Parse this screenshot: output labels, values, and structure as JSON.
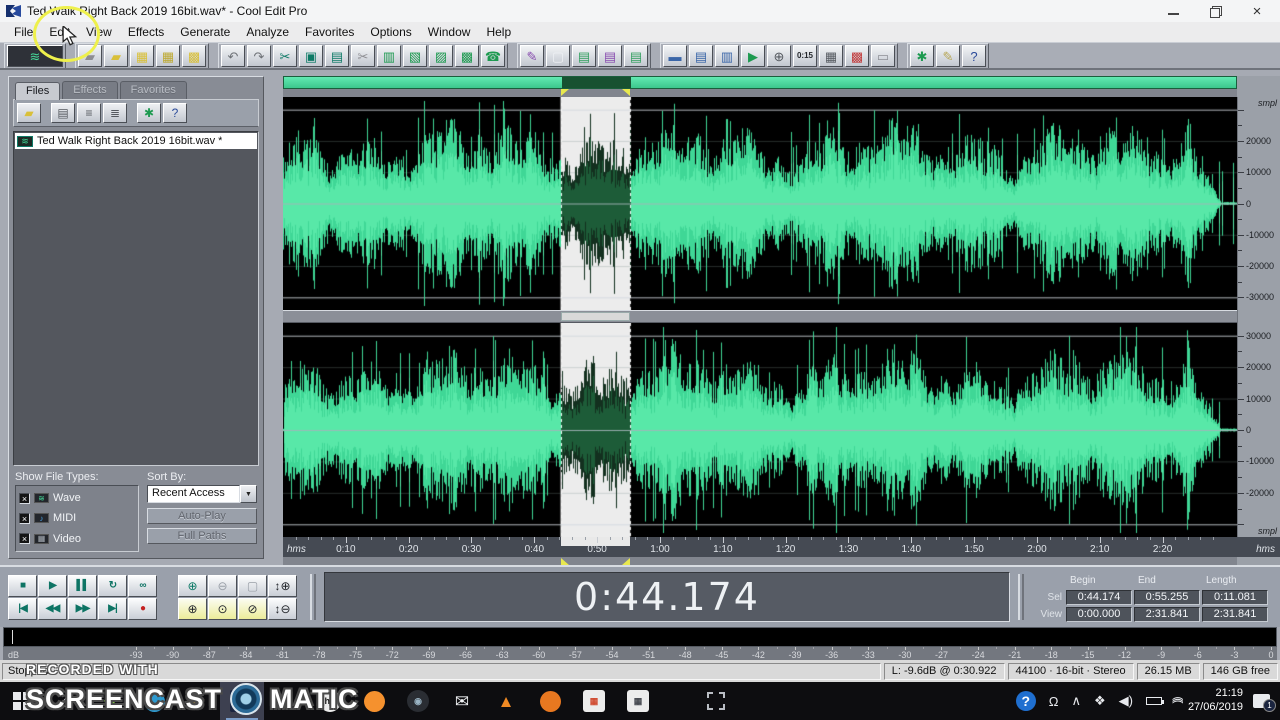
{
  "window": {
    "title": "Ted Walk Right Back 2019 16bit.wav* - Cool Edit Pro",
    "close_glyph": "×"
  },
  "menu": {
    "items": [
      "File",
      "Edit",
      "View",
      "Effects",
      "Generate",
      "Analyze",
      "Favorites",
      "Options",
      "Window",
      "Help"
    ]
  },
  "toolbar": {
    "groups": [
      {
        "name": "view",
        "buttons": [
          {
            "name": "waveform-view-toggle",
            "glyph": "≋",
            "color": "#45d898",
            "wide": true
          }
        ]
      },
      {
        "name": "file",
        "buttons": [
          {
            "name": "new-file-button",
            "glyph": "▰",
            "color": "#8d8d92"
          },
          {
            "name": "open-file-button",
            "glyph": "▰",
            "color": "#d9c03a"
          },
          {
            "name": "save-file-button",
            "glyph": "▦",
            "color": "#d9c03a"
          },
          {
            "name": "save-as-button",
            "glyph": "▦",
            "color": "#bda931"
          },
          {
            "name": "save-all-button",
            "glyph": "▩",
            "color": "#d9c03a"
          }
        ]
      },
      {
        "name": "edit",
        "buttons": [
          {
            "name": "undo-button",
            "glyph": "↶",
            "color": "#6e7277"
          },
          {
            "name": "redo-button",
            "glyph": "↷",
            "color": "#6e7277"
          },
          {
            "name": "cut-button",
            "glyph": "✂",
            "color": "#0d7a66"
          },
          {
            "name": "trim-button",
            "glyph": "▣",
            "color": "#0d7a66"
          },
          {
            "name": "copy-button",
            "glyph": "▤",
            "color": "#0d7a66"
          },
          {
            "name": "delete-button",
            "glyph": "✂",
            "color": "#8d8d92"
          },
          {
            "name": "paste-button",
            "glyph": "▥",
            "color": "#1d9a50"
          },
          {
            "name": "mix-paste-button",
            "glyph": "▧",
            "color": "#1d9a50"
          },
          {
            "name": "paste-to-new-button",
            "glyph": "▨",
            "color": "#1d9a50"
          },
          {
            "name": "convert-sample-type-button",
            "glyph": "▩",
            "color": "#1d9a50"
          },
          {
            "name": "cue-list-button",
            "glyph": "☎",
            "color": "#1d9a50"
          }
        ]
      },
      {
        "name": "mode",
        "buttons": [
          {
            "name": "spectral-view-button",
            "glyph": "✎",
            "color": "#8a4fb0"
          },
          {
            "name": "pan-view-button",
            "glyph": "▢",
            "color": "#eef0f4"
          },
          {
            "name": "multitrack-view-button",
            "glyph": "▤",
            "color": "#34a060"
          },
          {
            "name": "track-mixer-button",
            "glyph": "▤",
            "color": "#8a4fb0"
          },
          {
            "name": "session-view-button",
            "glyph": "▤",
            "color": "#34a060"
          }
        ]
      },
      {
        "name": "window",
        "buttons": [
          {
            "name": "wave-window-button",
            "glyph": "▬",
            "color": "#3a66a8"
          },
          {
            "name": "organizer-window-button",
            "glyph": "▤",
            "color": "#3a66a8"
          },
          {
            "name": "properties-window-button",
            "glyph": "▥",
            "color": "#3a66a8"
          },
          {
            "name": "play-window-button",
            "glyph": "▶",
            "color": "#1d9a50"
          },
          {
            "name": "zoom-window-button",
            "glyph": "⊕",
            "color": "#555a60"
          },
          {
            "name": "time-window-button",
            "glyph": "0:15",
            "color": "#23262b",
            "text": true
          },
          {
            "name": "keyboard-window-button",
            "glyph": "▦",
            "color": "#555a60"
          },
          {
            "name": "mixer-window-button",
            "glyph": "▩",
            "color": "#c23a3a"
          },
          {
            "name": "blank-window-button",
            "glyph": "▭",
            "color": "#8d9096"
          }
        ]
      },
      {
        "name": "misc",
        "buttons": [
          {
            "name": "scripts-button",
            "glyph": "✱",
            "color": "#1d9a50"
          },
          {
            "name": "pencil-tool-button",
            "glyph": "✎",
            "color": "#b8a858"
          },
          {
            "name": "help-button",
            "glyph": "?",
            "color": "#2a4a9a"
          }
        ]
      }
    ]
  },
  "left_panel": {
    "tabs": [
      {
        "label": "Files",
        "active": true
      },
      {
        "label": "Effects",
        "active": false
      },
      {
        "label": "Favorites",
        "active": false
      }
    ],
    "toolbar": [
      {
        "name": "panel-open-file-button",
        "glyph": "▰",
        "color": "#d9c03a"
      },
      {
        "name": "panel-sort-name-button",
        "glyph": "▤",
        "color": "#55595f"
      },
      {
        "name": "panel-sort-type-button",
        "glyph": "≡",
        "color": "#55595f"
      },
      {
        "name": "panel-sort-date-button",
        "glyph": "≣",
        "color": "#55595f"
      },
      {
        "name": "panel-options-button",
        "glyph": "✱",
        "color": "#1d9a50"
      },
      {
        "name": "panel-help-button",
        "glyph": "?",
        "color": "#2a4a9a"
      }
    ],
    "file_icon": {
      "glyph": "≋",
      "color": "#3fd796"
    },
    "files": [
      "Ted Walk Right Back 2019 16bit.wav *"
    ],
    "show_file_types_label": "Show File Types:",
    "check_glyph": "×",
    "file_types": [
      {
        "label": "Wave",
        "icon_glyph": "≋",
        "icon_color": "#45d898"
      },
      {
        "label": "MIDI",
        "icon_glyph": "♪",
        "icon_color": "#4aa3e8"
      },
      {
        "label": "Video",
        "icon_glyph": "▦",
        "icon_color": "#aab0b8"
      }
    ],
    "sort_by_label": "Sort By:",
    "sort_by_value": "Recent Access",
    "dropdown_arrow": "▼",
    "auto_play_label": "Auto-Play",
    "full_paths_label": "Full Paths"
  },
  "waveform": {
    "duration_sec": 151.841,
    "selection_begin_sec": 44.174,
    "selection_end_sec": 55.255,
    "ruler_unit": "smpl",
    "timeline_unit": "hms",
    "ruler_labels_top": [
      20000,
      10000,
      0,
      -10000,
      -20000,
      -30000
    ],
    "ruler_labels_bottom": [
      30000,
      20000,
      10000,
      0,
      -10000,
      -20000
    ],
    "time_ticks": [
      {
        "t": 10,
        "label": "0:10"
      },
      {
        "t": 20,
        "label": "0:20"
      },
      {
        "t": 30,
        "label": "0:30"
      },
      {
        "t": 40,
        "label": "0:40"
      },
      {
        "t": 50,
        "label": "0:50"
      },
      {
        "t": 60,
        "label": "1:00"
      },
      {
        "t": 70,
        "label": "1:10"
      },
      {
        "t": 80,
        "label": "1:20"
      },
      {
        "t": 90,
        "label": "1:30"
      },
      {
        "t": 100,
        "label": "1:40"
      },
      {
        "t": 110,
        "label": "1:50"
      },
      {
        "t": 120,
        "label": "2:00"
      },
      {
        "t": 130,
        "label": "2:10"
      },
      {
        "t": 140,
        "label": "2:20"
      }
    ],
    "colors": {
      "wave": "#3fd796",
      "wave_bright": "#58e8a8",
      "wave_selected": "#1d5c38",
      "wave_selected_dark": "#13301f",
      "selection_bg": "#ececec",
      "background": "#000000",
      "overview_selection": "#175130",
      "marker": "#e8e84e"
    }
  },
  "transport": {
    "rows": [
      [
        {
          "name": "stop-button",
          "glyph": "■",
          "color": "#0e7464"
        },
        {
          "name": "play-button",
          "glyph": "▶",
          "color": "#0e7464"
        },
        {
          "name": "pause-button",
          "glyph": "▌▌",
          "color": "#0e7464"
        },
        {
          "name": "play-looped-button",
          "glyph": "↻",
          "color": "#0e7464"
        },
        {
          "name": "loop-button",
          "glyph": "∞",
          "color": "#0e7464"
        }
      ],
      [
        {
          "name": "go-to-beginning-button",
          "glyph": "|◀",
          "color": "#0e7464"
        },
        {
          "name": "rewind-button",
          "glyph": "◀◀",
          "color": "#0e7464"
        },
        {
          "name": "fast-forward-button",
          "glyph": "▶▶",
          "color": "#0e7464"
        },
        {
          "name": "go-to-end-button",
          "glyph": "▶|",
          "color": "#0e7464"
        },
        {
          "name": "record-button",
          "glyph": "●",
          "color": "#c42222"
        }
      ]
    ]
  },
  "zoom_controls": {
    "rows": [
      [
        {
          "name": "zoom-in-button",
          "glyph": "⊕",
          "color": "#0d7a66"
        },
        {
          "name": "zoom-out-button",
          "glyph": "⊖",
          "color": "#9aa0a8"
        },
        {
          "name": "zoom-full-button",
          "glyph": "▢",
          "color": "#9aa0a8"
        },
        {
          "name": "vertical-zoom-in-button",
          "glyph": "↕⊕",
          "color": "#23262b"
        }
      ],
      [
        {
          "name": "zoom-to-selection-left-button",
          "glyph": "⊕",
          "color": "#23262b",
          "yellow": true
        },
        {
          "name": "zoom-to-selection-button",
          "glyph": "⊙",
          "color": "#23262b",
          "yellow": true
        },
        {
          "name": "zoom-to-selection-right-button",
          "glyph": "⊘",
          "color": "#23262b",
          "yellow": true
        },
        {
          "name": "vertical-zoom-out-button",
          "glyph": "↕⊖",
          "color": "#23262b"
        }
      ]
    ]
  },
  "time_display": "0:44.174",
  "sel_view": {
    "headers": [
      "Begin",
      "End",
      "Length"
    ],
    "sel_label": "Sel",
    "view_label": "View",
    "sel": {
      "begin": "0:44.174",
      "end": "0:55.255",
      "length": "0:11.081"
    },
    "view": {
      "begin": "0:00.000",
      "end": "2:31.841",
      "length": "2:31.841"
    }
  },
  "meter": {
    "unit": "dB",
    "labels": [
      "-93",
      "-90",
      "-87",
      "-84",
      "-81",
      "-78",
      "-75",
      "-72",
      "-69",
      "-66",
      "-63",
      "-60",
      "-57",
      "-54",
      "-51",
      "-48",
      "-45",
      "-42",
      "-39",
      "-36",
      "-33",
      "-30",
      "-27",
      "-24",
      "-21",
      "-18",
      "-15",
      "-12",
      "-9",
      "-6",
      "-3",
      "0"
    ]
  },
  "status_bar": {
    "state": "Stopped",
    "cursor": "L: -9.6dB @ 0:30.922",
    "format": "44100 · 16-bit · Stereo",
    "file_size": "26.15 MB",
    "free_space": "146 GB free"
  },
  "watermark": {
    "recorded": "RECORDED WITH",
    "brand_left": "SCREENCAST",
    "brand_right": "MATIC"
  },
  "taskbar": {
    "time": "21:19",
    "date": "27/06/2019",
    "badge": "1",
    "apps": [
      {
        "name": "start-button",
        "kind": "win"
      },
      {
        "name": "taskbar-app-home",
        "kind": "glyph",
        "glyph": "⌂",
        "color": "#dcdee2"
      },
      {
        "name": "taskbar-app-green",
        "kind": "glyph",
        "glyph": "❖",
        "color": "#7dc243"
      },
      {
        "name": "taskbar-app-blue",
        "kind": "circle",
        "color": "#2e9ad0"
      },
      {
        "name": "taskbar-app-explorer",
        "kind": "glyph",
        "glyph": "▰",
        "color": "#e3bf3c"
      },
      {
        "name": "taskbar-app-cooledit",
        "kind": "cooledit",
        "active": true
      },
      {
        "name": "taskbar-app-edge",
        "kind": "letter",
        "glyph": "e",
        "color": "#35a6e8"
      },
      {
        "name": "taskbar-app-hp",
        "kind": "badge",
        "glyph": "hp",
        "bg": "#ececec",
        "fg": "#1a1a1a",
        "round": true
      },
      {
        "name": "taskbar-app-firefox",
        "kind": "circle",
        "color": "#f5912e"
      },
      {
        "name": "taskbar-app-webcam",
        "kind": "badge",
        "glyph": "◉",
        "bg": "#2a2d33",
        "fg": "#9ab4c4",
        "round": true
      },
      {
        "name": "taskbar-app-mail",
        "kind": "glyph",
        "glyph": "✉",
        "color": "#f0f2f4"
      },
      {
        "name": "taskbar-app-vlc",
        "kind": "glyph",
        "glyph": "▲",
        "color": "#f08a24"
      },
      {
        "name": "taskbar-app-mediaplayer",
        "kind": "circle",
        "color": "#e87820"
      },
      {
        "name": "taskbar-app-store",
        "kind": "badge",
        "glyph": "▦",
        "bg": "#ececec",
        "fg": "#d04a30"
      },
      {
        "name": "taskbar-app-calculator",
        "kind": "badge",
        "glyph": "▦",
        "bg": "#ececec",
        "fg": "#44474e"
      },
      {
        "name": "taskbar-app-select",
        "kind": "dashed",
        "gap": true
      }
    ],
    "tray": [
      {
        "name": "tray-help-icon",
        "kind": "badge",
        "glyph": "?",
        "bg": "#1f6fd0",
        "fg": "#fff",
        "round": true
      },
      {
        "name": "tray-people-icon",
        "kind": "glyph",
        "glyph": "Ω",
        "color": "#e8eaee"
      },
      {
        "name": "tray-chevron-up-icon",
        "kind": "glyph",
        "glyph": "∧",
        "color": "#e8eaee"
      },
      {
        "name": "tray-dropbox-icon",
        "kind": "glyph",
        "glyph": "❖",
        "color": "#e8eaee"
      },
      {
        "name": "tray-volume-icon",
        "kind": "glyph",
        "glyph": "◀)",
        "color": "#e8eaee"
      },
      {
        "name": "tray-battery-icon",
        "kind": "battery"
      },
      {
        "name": "tray-wifi-icon",
        "kind": "wifi",
        "glyph": ")))"
      }
    ]
  }
}
